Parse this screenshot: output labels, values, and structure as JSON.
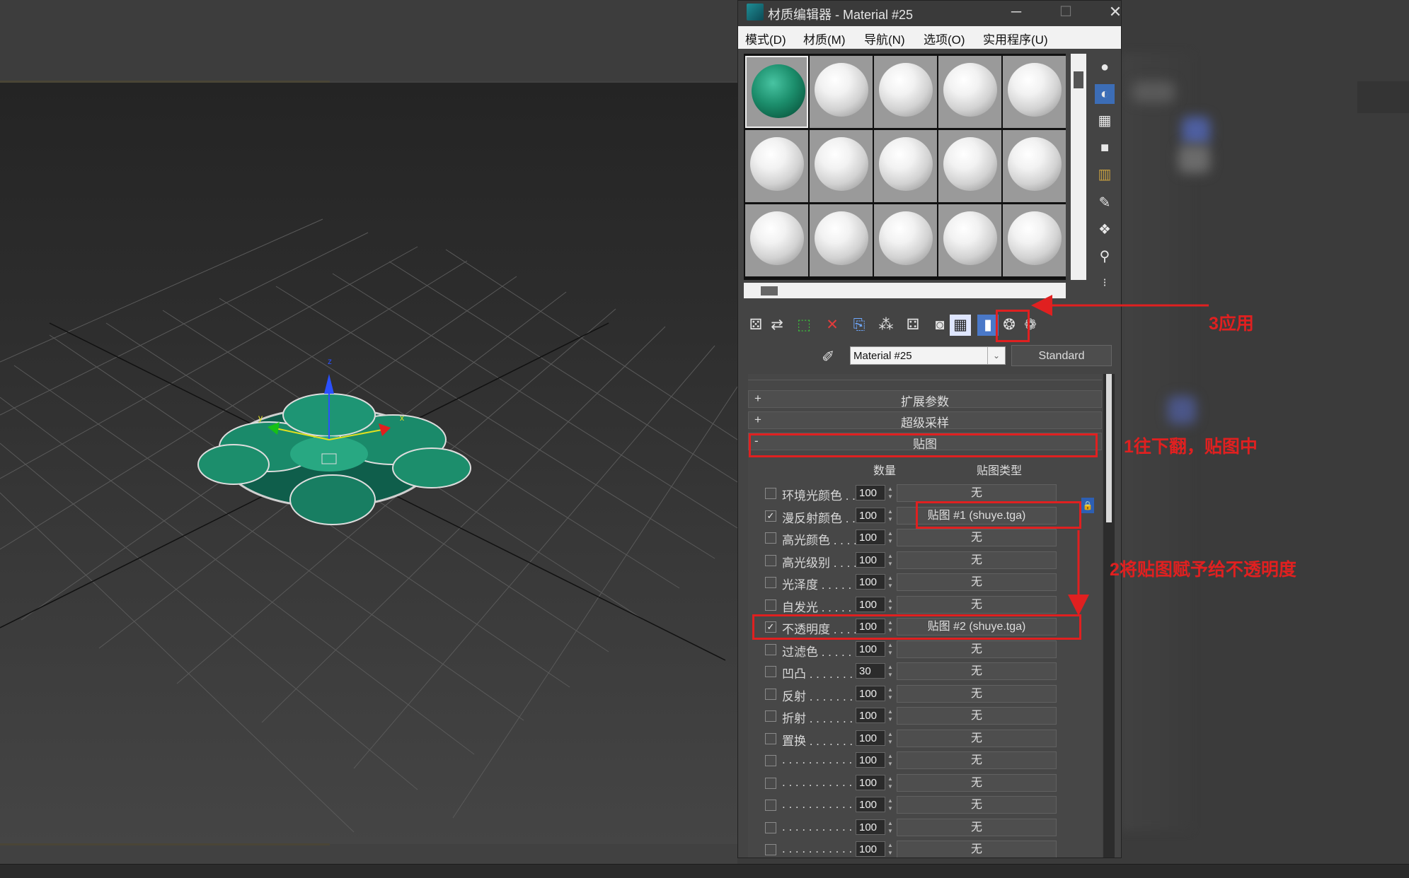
{
  "window": {
    "title": "材质编辑器 - Material #25",
    "minimize": "─",
    "maximize": "☐",
    "close": "✕"
  },
  "menu": [
    "模式(D)",
    "材质(M)",
    "导航(N)",
    "选项(O)",
    "实用程序(U)"
  ],
  "viewport": {
    "axis_labels": {
      "z": "z",
      "x": "x",
      "y": "y"
    }
  },
  "material": {
    "name": "Material #25",
    "type": "Standard",
    "picker_icon": "eyedropper-icon"
  },
  "rollouts": [
    {
      "sign": "+",
      "title": "扩展参数"
    },
    {
      "sign": "+",
      "title": "超级采样"
    },
    {
      "sign": "-",
      "title": "贴图"
    }
  ],
  "maps": {
    "amount_header": "数量",
    "type_header": "贴图类型",
    "rows": [
      {
        "label": "环境光颜色 . . .",
        "checked": false,
        "amount": "100",
        "map": "无"
      },
      {
        "label": "漫反射颜色 . . .",
        "checked": true,
        "amount": "100",
        "map": "贴图 #1 (shuye.tga)"
      },
      {
        "label": "高光颜色 . . . . .",
        "checked": false,
        "amount": "100",
        "map": "无"
      },
      {
        "label": "高光级别 . . . . .",
        "checked": false,
        "amount": "100",
        "map": "无"
      },
      {
        "label": "光泽度 . . . . . . .",
        "checked": false,
        "amount": "100",
        "map": "无"
      },
      {
        "label": "自发光 . . . . . . .",
        "checked": false,
        "amount": "100",
        "map": "无"
      },
      {
        "label": "不透明度 . . . . .",
        "checked": true,
        "amount": "100",
        "map": "贴图 #2 (shuye.tga)"
      },
      {
        "label": "过滤色 . . . . . . .",
        "checked": false,
        "amount": "100",
        "map": "无"
      },
      {
        "label": "凹凸 . . . . . . . . .",
        "checked": false,
        "amount": "30",
        "map": "无"
      },
      {
        "label": "反射 . . . . . . . . .",
        "checked": false,
        "amount": "100",
        "map": "无"
      },
      {
        "label": "折射 . . . . . . . . .",
        "checked": false,
        "amount": "100",
        "map": "无"
      },
      {
        "label": "置换 . . . . . . . . .",
        "checked": false,
        "amount": "100",
        "map": "无"
      },
      {
        "label": ". . . . . . . . . . . . .",
        "checked": false,
        "amount": "100",
        "map": "无"
      },
      {
        "label": ". . . . . . . . . . . . .",
        "checked": false,
        "amount": "100",
        "map": "无"
      },
      {
        "label": ". . . . . . . . . . . . .",
        "checked": false,
        "amount": "100",
        "map": "无"
      },
      {
        "label": ". . . . . . . . . . . . .",
        "checked": false,
        "amount": "100",
        "map": "无"
      },
      {
        "label": ". . . . . . . . . . . . .",
        "checked": false,
        "amount": "100",
        "map": "无"
      }
    ]
  },
  "annotations": {
    "step1": "1往下翻，贴图中",
    "step2": "2将贴图赋予给不透明度",
    "step3": "3应用"
  },
  "colors": {
    "annotation_red": "#e02020",
    "viewport_bg": "#414141",
    "active_material": "#1c8e6c"
  }
}
